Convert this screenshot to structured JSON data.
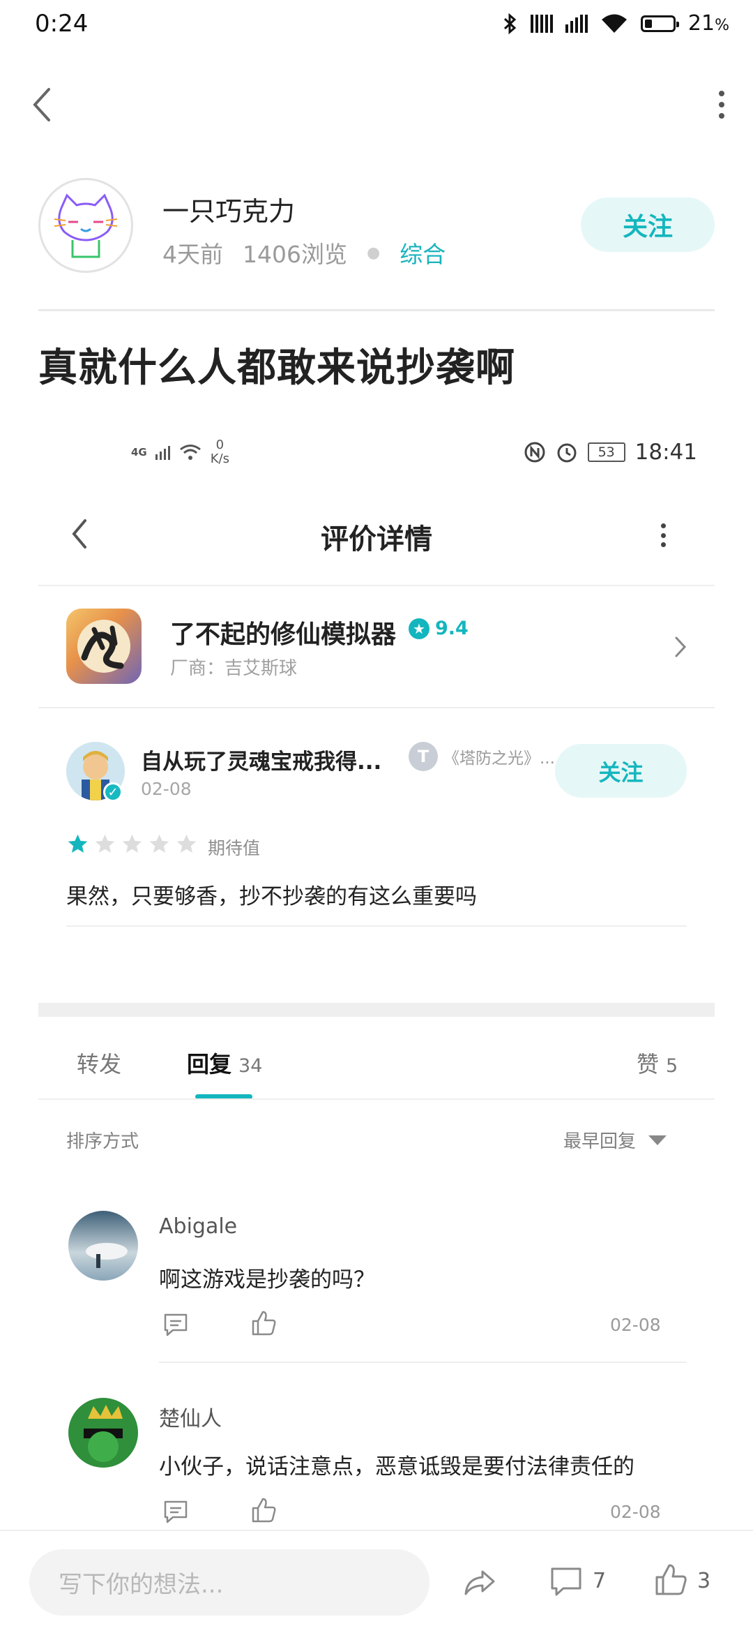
{
  "status_bar": {
    "time": "0:24",
    "battery": "21",
    "battery_unit": "%"
  },
  "author": {
    "name": "一只巧克力",
    "time_ago": "4天前",
    "views": "1406浏览",
    "category": "综合",
    "follow_label": "关注"
  },
  "post": {
    "title": "真就什么人都敢来说抄袭啊"
  },
  "embedded": {
    "status": {
      "network": "4G",
      "speed_value": "0",
      "speed_unit": "K/s",
      "battery": "53",
      "time": "18:41"
    },
    "page_title": "评价详情",
    "game": {
      "name": "了不起的修仙模拟器",
      "score": "9.4",
      "developer": "厂商：吉艾斯球"
    },
    "review": {
      "user_name": "自从玩了灵魂宝戒我得...",
      "tag_icon": "T",
      "tag_text": "《塔防之光》...",
      "date": "02-08",
      "follow_label": "关注",
      "rating": 1,
      "rating_max": 5,
      "rating_label": "期待值",
      "content": "果然，只要够香，抄不抄袭的有这么重要吗"
    }
  },
  "tabs": {
    "repost": "转发",
    "reply": "回复",
    "reply_count": "34",
    "like": "赞",
    "like_count": "5"
  },
  "sort": {
    "label": "排序方式",
    "value": "最早回复"
  },
  "comments": [
    {
      "name": "Abigale",
      "text": "啊这游戏是抄袭的吗？",
      "date": "02-08"
    },
    {
      "name": "楚仙人",
      "text": "小伙子，说话注意点，恶意诋毁是要付法律责任的",
      "date": "02-08"
    }
  ],
  "bottom_bar": {
    "input_placeholder": "写下你的想法...",
    "comment_count": "7",
    "like_count": "3"
  },
  "colors": {
    "accent": "#14b6be",
    "follow_bg": "#e6f7f7",
    "star_filled": "#14b6be",
    "star_empty": "#dddddd"
  },
  "icons": [
    "back-icon",
    "more-icon",
    "share-icon",
    "comment-icon",
    "like-icon",
    "bluetooth-icon",
    "wifi-icon",
    "battery-icon"
  ]
}
